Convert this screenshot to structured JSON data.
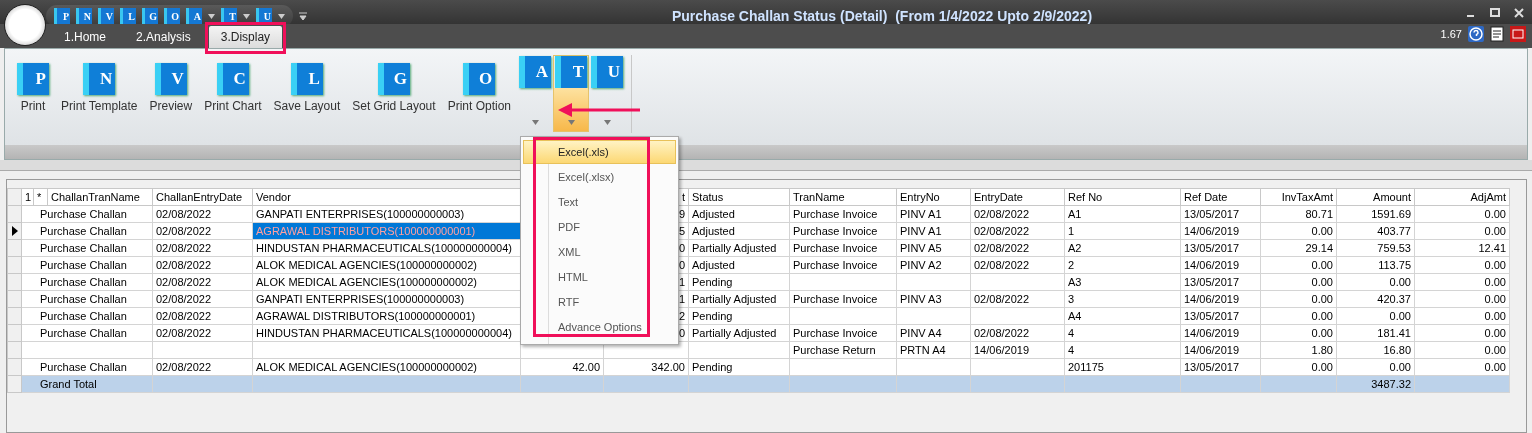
{
  "window": {
    "title": "Purchase Challan Status (Detail)  (From 1/4/2022 Upto 2/9/2022)"
  },
  "quick_access": [
    {
      "letter": "P",
      "dropdown": false
    },
    {
      "letter": "N",
      "dropdown": false
    },
    {
      "letter": "V",
      "dropdown": false
    },
    {
      "letter": "L",
      "dropdown": false
    },
    {
      "letter": "G",
      "dropdown": false
    },
    {
      "letter": "O",
      "dropdown": false
    },
    {
      "letter": "A",
      "dropdown": true
    },
    {
      "letter": "T",
      "dropdown": true
    },
    {
      "letter": "U",
      "dropdown": true
    }
  ],
  "tabs": [
    {
      "label": "1.Home",
      "selected": false,
      "highlighted": false
    },
    {
      "label": "2.Analysis",
      "selected": false,
      "highlighted": false
    },
    {
      "label": "3.Display",
      "selected": true,
      "highlighted": true
    }
  ],
  "version": "1.67",
  "ribbon": [
    {
      "kind": "button",
      "letter": "P",
      "label": "Print"
    },
    {
      "kind": "button",
      "letter": "N",
      "label": "Print Template"
    },
    {
      "kind": "button",
      "letter": "V",
      "label": "Preview"
    },
    {
      "kind": "button",
      "letter": "C",
      "label": "Print Chart"
    },
    {
      "kind": "button",
      "letter": "L",
      "label": "Save Layout"
    },
    {
      "kind": "button",
      "letter": "G",
      "label": "Set Grid Layout"
    },
    {
      "kind": "button",
      "letter": "O",
      "label": "Print Option"
    },
    {
      "kind": "split",
      "letter": "A",
      "open": false
    },
    {
      "kind": "split",
      "letter": "T",
      "open": true
    },
    {
      "kind": "split",
      "letter": "U",
      "open": false
    }
  ],
  "export_menu": {
    "highlighted": true,
    "items": [
      {
        "label": "Excel(.xls)",
        "selected": true
      },
      {
        "label": "Excel(.xlsx)",
        "selected": false
      },
      {
        "label": "Text",
        "selected": false
      },
      {
        "label": "PDF",
        "selected": false
      },
      {
        "label": "XML",
        "selected": false
      },
      {
        "label": "HTML",
        "selected": false
      },
      {
        "label": "RTF",
        "selected": false
      },
      {
        "label": "Advance Options",
        "selected": false
      }
    ]
  },
  "pointer_arrow": true,
  "table": {
    "marks": [
      "1",
      "*"
    ],
    "columns": [
      {
        "label": "ChallanTranName",
        "kind": "text"
      },
      {
        "label": "ChallanEntryDate",
        "kind": "text"
      },
      {
        "label": "Vendor",
        "kind": "text"
      },
      {
        "kind": "number"
      },
      {
        "label": "t",
        "kind": "number"
      },
      {
        "label": "Status",
        "kind": "text"
      },
      {
        "label": "TranName",
        "kind": "text"
      },
      {
        "label": "EntryNo",
        "kind": "text"
      },
      {
        "label": "EntryDate",
        "kind": "text"
      },
      {
        "label": "Ref No",
        "kind": "text"
      },
      {
        "label": "Ref Date",
        "kind": "text"
      },
      {
        "label": "InvTaxAmt",
        "kind": "number"
      },
      {
        "label": "Amount",
        "kind": "number"
      },
      {
        "label": "AdjAmt",
        "kind": "number"
      }
    ],
    "rows": [
      {
        "selected": false,
        "kind": "data",
        "cells": [
          "Purchase Challan",
          "02/08/2022",
          "GANPATI ENTERPRISES(100000000003)",
          null,
          "9",
          "Adjusted",
          "Purchase Invoice",
          "PINV A1",
          "02/08/2022",
          "A1",
          "13/05/2017",
          "80.71",
          "1591.69",
          "0.00"
        ]
      },
      {
        "selected": true,
        "kind": "data",
        "cells": [
          "Purchase Challan",
          "02/08/2022",
          "AGRAWAL DISTRIBUTORS(100000000001)",
          null,
          "5",
          "Adjusted",
          "Purchase Invoice",
          "PINV A1",
          "02/08/2022",
          "1",
          "14/06/2019",
          "0.00",
          "403.77",
          "0.00"
        ]
      },
      {
        "selected": false,
        "kind": "data",
        "cells": [
          "Purchase Challan",
          "02/08/2022",
          "HINDUSTAN PHARMACEUTICALS(100000000004)",
          null,
          "0",
          "Partially Adjusted",
          "Purchase Invoice",
          "PINV A5",
          "02/08/2022",
          "A2",
          "13/05/2017",
          "29.14",
          "759.53",
          "12.41"
        ]
      },
      {
        "selected": false,
        "kind": "data",
        "cells": [
          "Purchase Challan",
          "02/08/2022",
          "ALOK MEDICAL AGENCIES(100000000002)",
          null,
          "0",
          "Adjusted",
          "Purchase Invoice",
          "PINV A2",
          "02/08/2022",
          "2",
          "14/06/2019",
          "0.00",
          "113.75",
          "0.00"
        ]
      },
      {
        "selected": false,
        "kind": "data",
        "cells": [
          "Purchase Challan",
          "02/08/2022",
          "ALOK MEDICAL AGENCIES(100000000002)",
          null,
          "1",
          "Pending",
          null,
          null,
          null,
          "A3",
          "13/05/2017",
          "0.00",
          "0.00",
          "0.00"
        ]
      },
      {
        "selected": false,
        "kind": "data",
        "cells": [
          "Purchase Challan",
          "02/08/2022",
          "GANPATI ENTERPRISES(100000000003)",
          null,
          "1",
          "Partially Adjusted",
          "Purchase Invoice",
          "PINV A3",
          "02/08/2022",
          "3",
          "14/06/2019",
          "0.00",
          "420.37",
          "0.00"
        ]
      },
      {
        "selected": false,
        "kind": "data",
        "cells": [
          "Purchase Challan",
          "02/08/2022",
          "AGRAWAL DISTRIBUTORS(100000000001)",
          null,
          "2",
          "Pending",
          null,
          null,
          null,
          "A4",
          "13/05/2017",
          "0.00",
          "0.00",
          "0.00"
        ]
      },
      {
        "selected": false,
        "kind": "data",
        "cells": [
          "Purchase Challan",
          "02/08/2022",
          "HINDUSTAN PHARMACEUTICALS(100000000004)",
          null,
          "0",
          "Partially Adjusted",
          "Purchase Invoice",
          "PINV A4",
          "02/08/2022",
          "4",
          "14/06/2019",
          "0.00",
          "181.41",
          "0.00"
        ]
      },
      {
        "selected": false,
        "kind": "data",
        "cells": [
          null,
          null,
          null,
          null,
          null,
          null,
          "Purchase Return",
          "PRTN A4",
          "14/06/2019",
          "4",
          "14/06/2019",
          "1.80",
          "16.80",
          "0.00"
        ]
      },
      {
        "selected": false,
        "kind": "data",
        "cells": [
          "Purchase Challan",
          "02/08/2022",
          "ALOK MEDICAL AGENCIES(100000000002)",
          "42.00",
          "342.00",
          "Pending",
          null,
          null,
          null,
          "201175",
          "13/05/2017",
          "0.00",
          "0.00",
          "0.00"
        ]
      },
      {
        "selected": false,
        "kind": "total",
        "cells": [
          "Grand Total",
          null,
          null,
          null,
          null,
          null,
          null,
          null,
          null,
          null,
          null,
          null,
          "3487.32",
          null
        ]
      }
    ]
  }
}
